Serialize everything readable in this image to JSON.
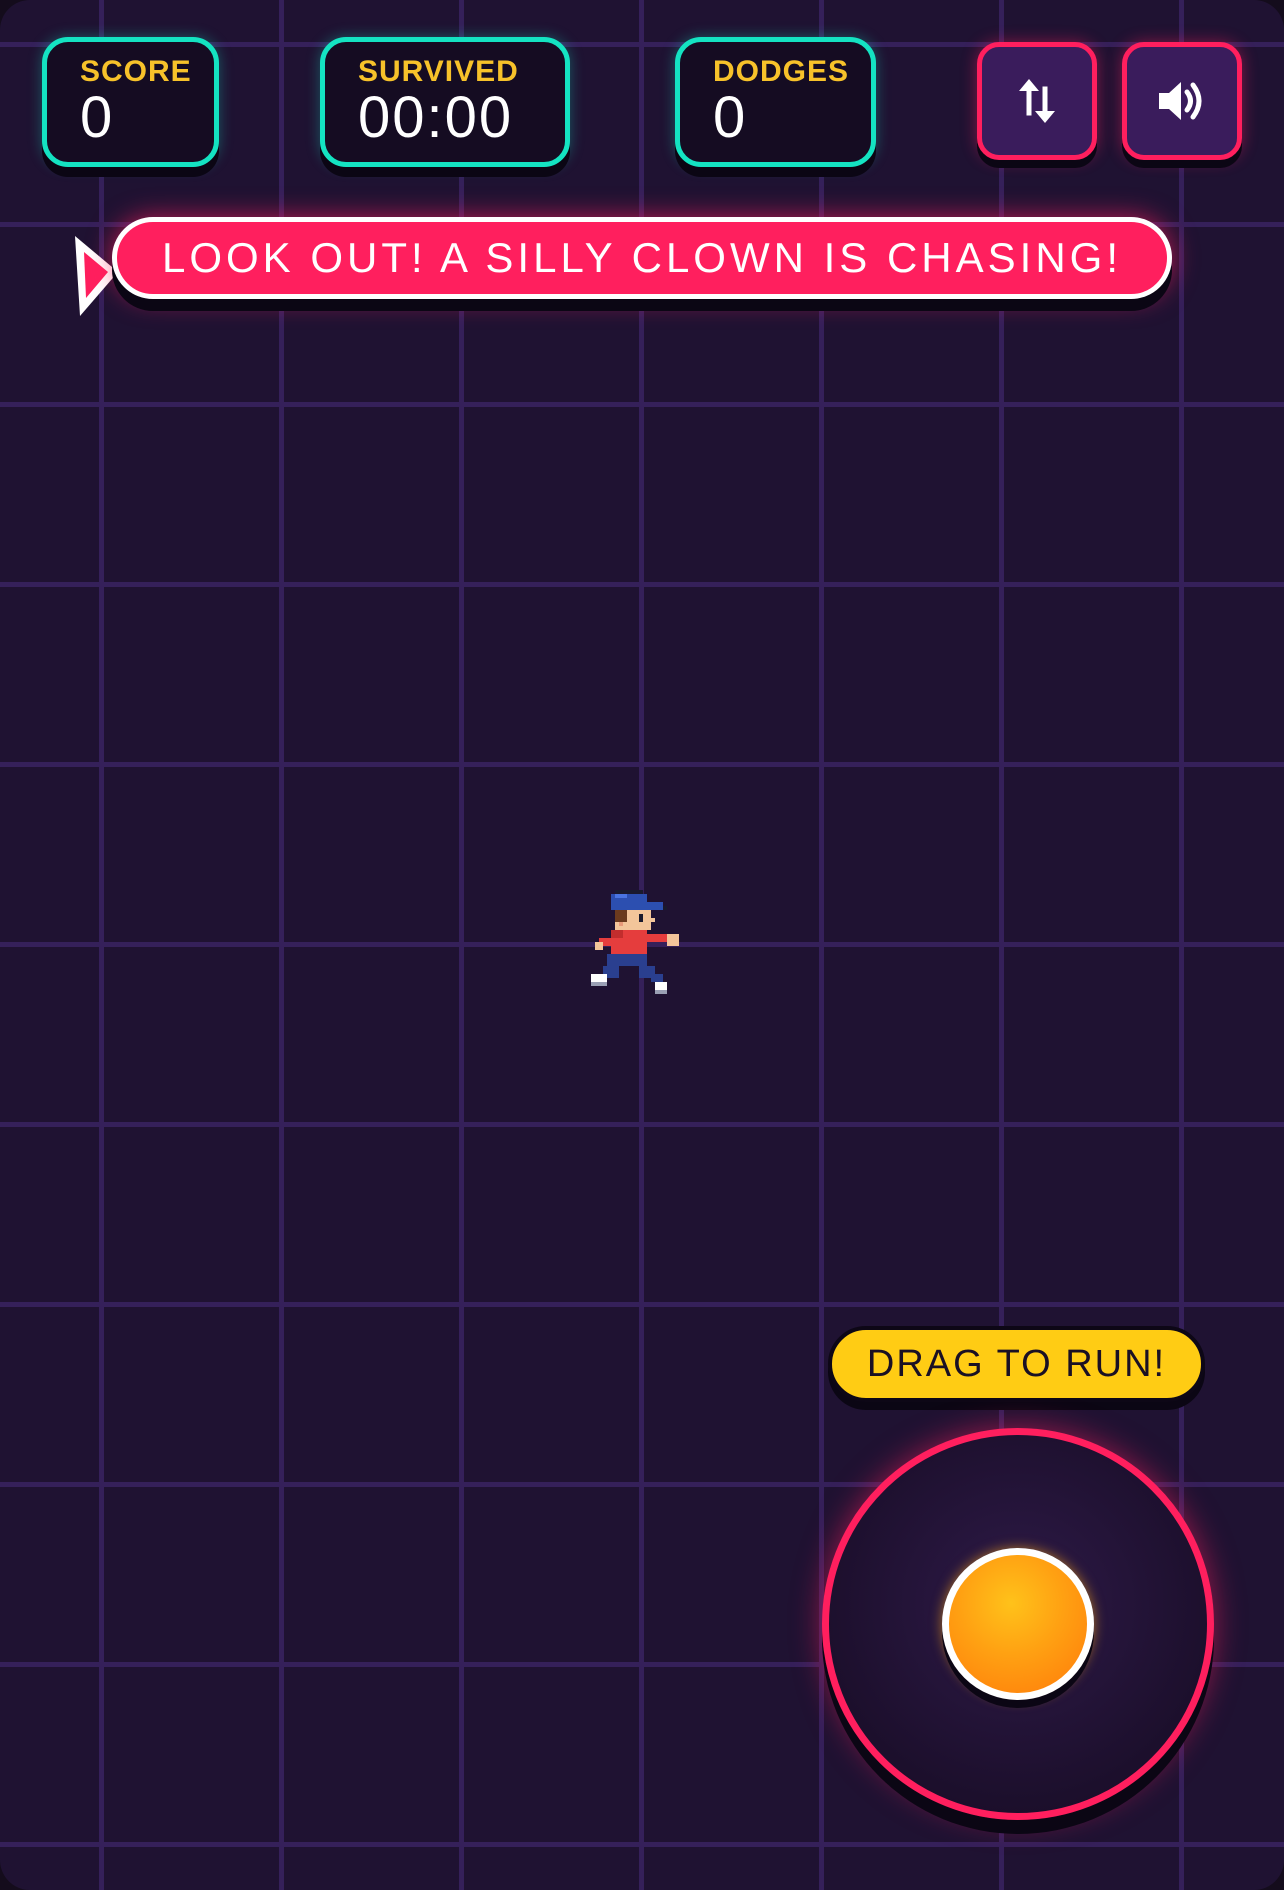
{
  "hud": {
    "score": {
      "label": "SCORE",
      "value": "0"
    },
    "survived": {
      "label": "SURVIVED",
      "value": "00:00"
    },
    "dodges": {
      "label": "DODGES",
      "value": "0"
    }
  },
  "buttons": {
    "swap": {
      "icon": "swap-arrows-icon"
    },
    "sound": {
      "icon": "speaker-icon"
    }
  },
  "banner": {
    "text": "LOOK OUT! A SILLY CLOWN IS CHASING!"
  },
  "player": {
    "icon": "running-boy-sprite"
  },
  "controls": {
    "hint": "DRAG TO RUN!"
  },
  "colors": {
    "background": "#1f1232",
    "grid": "#35205a",
    "teal_accent": "#14e3c2",
    "label_yellow": "#f7c22a",
    "pink_accent": "#ff1f5e",
    "hint_yellow": "#ffcc14",
    "knob_orange": "#ffa012"
  }
}
